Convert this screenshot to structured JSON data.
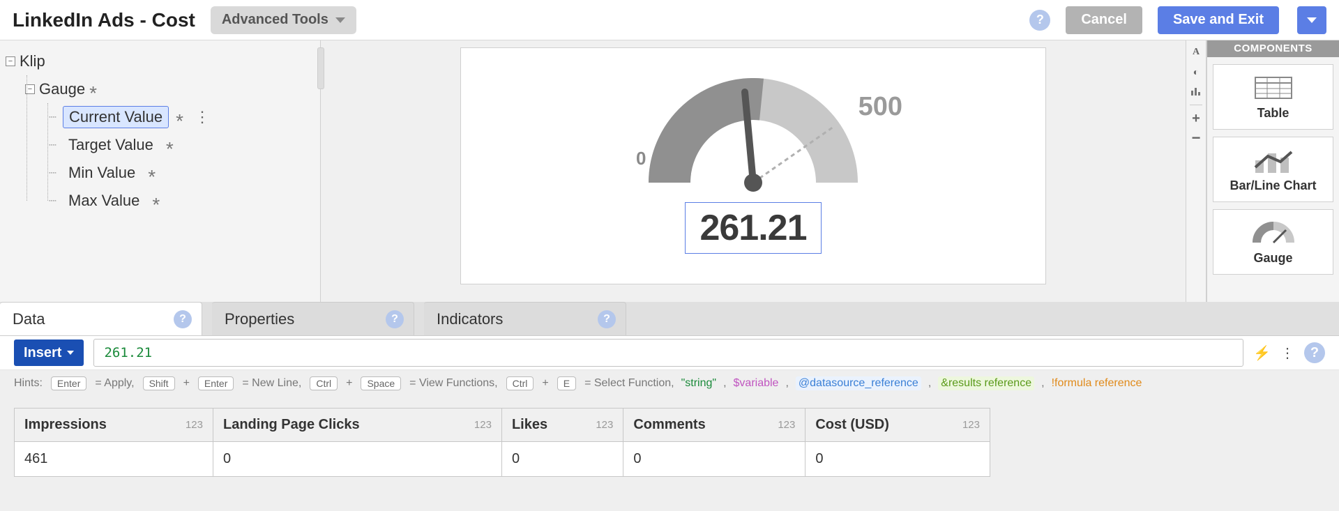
{
  "header": {
    "title": "LinkedIn Ads - Cost",
    "advanced_tools": "Advanced Tools",
    "cancel": "Cancel",
    "save_exit": "Save and Exit"
  },
  "tree": {
    "root": "Klip",
    "gauge": "Gauge",
    "items": [
      {
        "label": "Current Value",
        "selected": true,
        "more": true
      },
      {
        "label": "Target Value",
        "selected": false,
        "more": false
      },
      {
        "label": "Min Value",
        "selected": false,
        "more": false
      },
      {
        "label": "Max Value",
        "selected": false,
        "more": false
      }
    ]
  },
  "gauge": {
    "min": "0",
    "max": "500",
    "value": "261.21"
  },
  "components": {
    "header": "COMPONENTS",
    "items": [
      "Table",
      "Bar/Line Chart",
      "Gauge"
    ]
  },
  "tabs": [
    {
      "label": "Data",
      "active": true
    },
    {
      "label": "Properties",
      "active": false
    },
    {
      "label": "Indicators",
      "active": false
    }
  ],
  "formula": {
    "insert": "Insert",
    "value": "261.21"
  },
  "hints": {
    "label": "Hints:",
    "apply": "= Apply,",
    "newline": "= New Line,",
    "viewfn": "= View Functions,",
    "selectfn": "= Select Function,",
    "keys": {
      "enter": "Enter",
      "shift": "Shift",
      "ctrl": "Ctrl",
      "space": "Space",
      "e": "E"
    },
    "tokens": {
      "string": "\"string\"",
      "variable": "$variable",
      "datasource": "@datasource_reference",
      "results": "&results reference",
      "formula": "!formula reference"
    }
  },
  "table": {
    "type_badge": "123",
    "headers": [
      "Impressions",
      "Landing Page Clicks",
      "Likes",
      "Comments",
      "Cost (USD)"
    ],
    "row": [
      "461",
      "0",
      "0",
      "0",
      "0"
    ]
  }
}
